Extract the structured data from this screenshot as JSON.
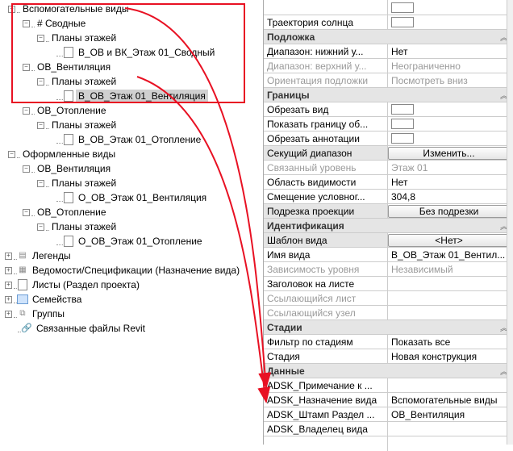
{
  "tree": {
    "n0": "Вспомогательные виды",
    "n1": "# Сводные",
    "n2": "Планы этажей",
    "n3": "В_ОВ и ВК_Этаж 01_Сводный",
    "n4": "ОВ_Вентиляция",
    "n5": "Планы этажей",
    "n6": "В_ОВ_Этаж 01_Вентиляция",
    "n7": "ОВ_Отопление",
    "n8": "Планы этажей",
    "n9": "В_ОВ_Этаж 01_Отопление",
    "n10": "Оформленные виды",
    "n11": "ОВ_Вентиляция",
    "n12": "Планы этажей",
    "n13": "О_ОВ_Этаж 01_Вентиляция",
    "n14": "ОВ_Отопление",
    "n15": "Планы этажей",
    "n16": "О_ОВ_Этаж 01_Отопление",
    "n17": "Легенды",
    "n18": "Ведомости/Спецификации (Назначение вида)",
    "n19": "Листы (Раздел проекта)",
    "n20": "Семейства",
    "n21": "Группы",
    "n22": "Связанные файлы Revit"
  },
  "props": {
    "sun": {
      "k": "Траектория солнца"
    },
    "g1": "Подложка",
    "u1": {
      "k": "Диапазон: нижний у...",
      "v": "Нет"
    },
    "u2": {
      "k": "Диапазон: верхний у...",
      "v": "Неограниченно"
    },
    "u3": {
      "k": "Ориентация подложки",
      "v": "Посмотреть вниз"
    },
    "g2": "Границы",
    "b1": {
      "k": "Обрезать вид"
    },
    "b2": {
      "k": "Показать границу об..."
    },
    "b3": {
      "k": "Обрезать аннотации"
    },
    "b4": {
      "k": "Секущий диапазон",
      "v": "Изменить..."
    },
    "b5": {
      "k": "Связанный уровень",
      "v": "Этаж 01"
    },
    "b6": {
      "k": "Область видимости",
      "v": "Нет"
    },
    "b7": {
      "k": "Смещение условног...",
      "v": "304,8"
    },
    "b8": {
      "k": "Подрезка проекции",
      "v": "Без подрезки"
    },
    "g3": "Идентификация",
    "i1": {
      "k": "Шаблон вида",
      "v": "<Нет>"
    },
    "i2": {
      "k": "Имя вида",
      "v": "В_ОВ_Этаж 01_Вентил..."
    },
    "i3": {
      "k": "Зависимость уровня",
      "v": "Независимый"
    },
    "i4": {
      "k": "Заголовок на листе"
    },
    "i5": {
      "k": "Ссылающийся лист"
    },
    "i6": {
      "k": "Ссылающийся узел"
    },
    "g4": "Стадии",
    "s1": {
      "k": "Фильтр по стадиям",
      "v": "Показать все"
    },
    "s2": {
      "k": "Стадия",
      "v": "Новая конструкция"
    },
    "g5": "Данные",
    "d1": {
      "k": "ADSK_Примечание к ..."
    },
    "d2": {
      "k": "ADSK_Назначение вида",
      "v": "Вспомогательные виды"
    },
    "d3": {
      "k": "ADSK_Штамп Раздел ...",
      "v": "ОВ_Вентиляция"
    },
    "d4": {
      "k": "ADSK_Владелец вида"
    }
  }
}
